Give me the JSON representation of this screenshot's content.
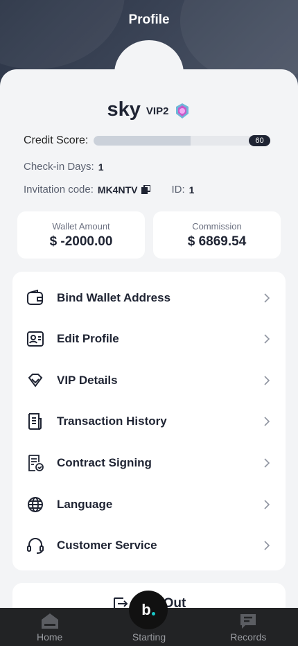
{
  "header": {
    "title": "Profile"
  },
  "user": {
    "name": "sky",
    "vip_level": "VIP2"
  },
  "credit": {
    "label": "Credit Score:",
    "value": "60",
    "fraction": 0.6
  },
  "checkin": {
    "label": "Check-in Days:",
    "value": "1"
  },
  "invitation": {
    "label": "Invitation code:",
    "code": "MK4NTV"
  },
  "account_id": {
    "label": "ID:",
    "value": "1"
  },
  "wallet": {
    "label": "Wallet Amount",
    "value": "$ -2000.00"
  },
  "commission": {
    "label": "Commission",
    "value": "$ 6869.54"
  },
  "menu": {
    "items": [
      {
        "label": "Bind Wallet Address",
        "icon": "wallet-icon"
      },
      {
        "label": "Edit Profile",
        "icon": "id-card-icon"
      },
      {
        "label": "VIP Details",
        "icon": "diamond-icon"
      },
      {
        "label": "Transaction History",
        "icon": "document-list-icon"
      },
      {
        "label": "Contract Signing",
        "icon": "contract-icon"
      },
      {
        "label": "Language",
        "icon": "globe-icon"
      },
      {
        "label": "Customer Service",
        "icon": "headset-icon"
      }
    ]
  },
  "logout": {
    "label": "Out",
    "icon": "logout-icon"
  },
  "tabs": [
    {
      "label": "Home",
      "icon": "home-icon"
    },
    {
      "label": "Starting",
      "icon": "brand-icon"
    },
    {
      "label": "Records",
      "icon": "records-icon"
    }
  ],
  "fab": {
    "letter": "b"
  },
  "colors": {
    "header": "#2f3849",
    "accent": "#1f2433",
    "tabbar": "#222325",
    "brand_dot": "#18c8c8"
  }
}
